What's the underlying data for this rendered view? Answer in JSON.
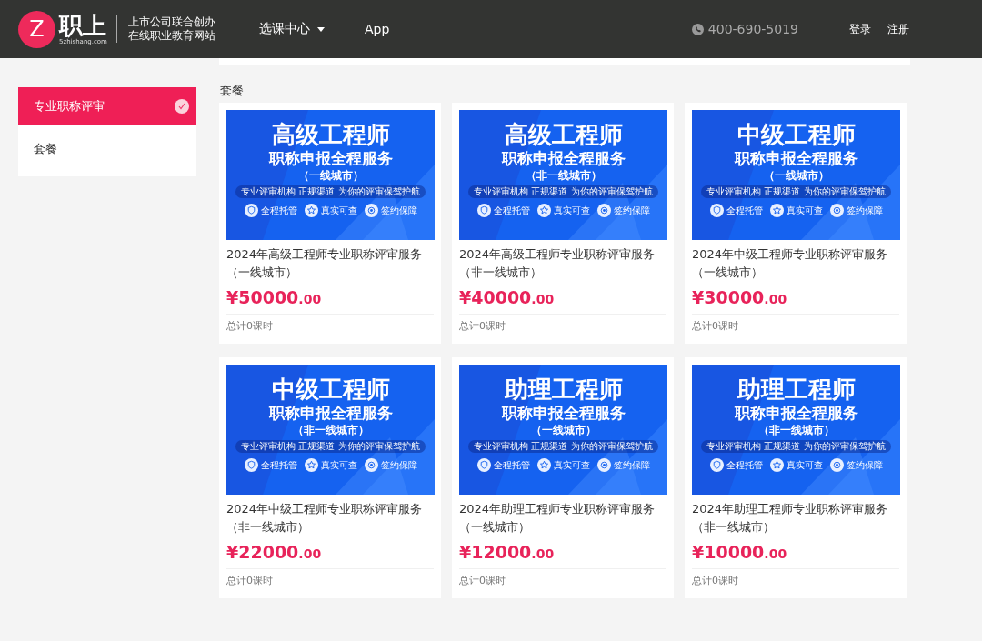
{
  "header": {
    "logo_mark": "Z",
    "logo_name": "职上",
    "logo_domain": "5zhishang.com",
    "slogan": [
      "上市公司联合创办",
      "在线职业教育网站"
    ],
    "nav": [
      {
        "label": "选课中心",
        "dropdown": true
      },
      {
        "label": "App",
        "dropdown": false
      }
    ],
    "phone": "400-690-5019",
    "links": [
      "登录",
      "注册"
    ]
  },
  "sidebar": {
    "items": [
      {
        "label": "专业职称评审",
        "selected": true
      },
      {
        "label": "套餐",
        "selected": false
      }
    ]
  },
  "section_title": "套餐",
  "cards": [
    {
      "banner": {
        "title": "高级工程师",
        "subtitle": "职称申报全程服务",
        "region": "（一线城市）",
        "tagline": "专业评审机构 正规渠道 为你的评审保驾护航",
        "badges": [
          "全程托管",
          "真实可查",
          "签约保障"
        ]
      },
      "name": "2024年高级工程师专业职称评审服务（一线城市）",
      "price": "¥50000",
      "cents": ".00",
      "hours": "总计0课时"
    },
    {
      "banner": {
        "title": "高级工程师",
        "subtitle": "职称申报全程服务",
        "region": "（非一线城市）",
        "tagline": "专业评审机构 正规渠道 为你的评审保驾护航",
        "badges": [
          "全程托管",
          "真实可查",
          "签约保障"
        ]
      },
      "name": "2024年高级工程师专业职称评审服务（非一线城市）",
      "price": "¥40000",
      "cents": ".00",
      "hours": "总计0课时"
    },
    {
      "banner": {
        "title": "中级工程师",
        "subtitle": "职称申报全程服务",
        "region": "（一线城市）",
        "tagline": "专业评审机构 正规渠道 为你的评审保驾护航",
        "badges": [
          "全程托管",
          "真实可查",
          "签约保障"
        ]
      },
      "name": "2024年中级工程师专业职称评审服务（一线城市）",
      "price": "¥30000",
      "cents": ".00",
      "hours": "总计0课时"
    },
    {
      "banner": {
        "title": "中级工程师",
        "subtitle": "职称申报全程服务",
        "region": "（非一线城市）",
        "tagline": "专业评审机构 正规渠道 为你的评审保驾护航",
        "badges": [
          "全程托管",
          "真实可查",
          "签约保障"
        ]
      },
      "name": "2024年中级工程师专业职称评审服务（非一线城市）",
      "price": "¥22000",
      "cents": ".00",
      "hours": "总计0课时"
    },
    {
      "banner": {
        "title": "助理工程师",
        "subtitle": "职称申报全程服务",
        "region": "（一线城市）",
        "tagline": "专业评审机构 正规渠道 为你的评审保驾护航",
        "badges": [
          "全程托管",
          "真实可查",
          "签约保障"
        ]
      },
      "name": "2024年助理工程师专业职称评审服务（一线城市）",
      "price": "¥12000",
      "cents": ".00",
      "hours": "总计0课时"
    },
    {
      "banner": {
        "title": "助理工程师",
        "subtitle": "职称申报全程服务",
        "region": "（非一线城市）",
        "tagline": "专业评审机构 正规渠道 为你的评审保驾护航",
        "badges": [
          "全程托管",
          "真实可查",
          "签约保障"
        ]
      },
      "name": "2024年助理工程师专业职称评审服务（非一线城市）",
      "price": "¥10000",
      "cents": ".00",
      "hours": "总计0课时"
    }
  ]
}
